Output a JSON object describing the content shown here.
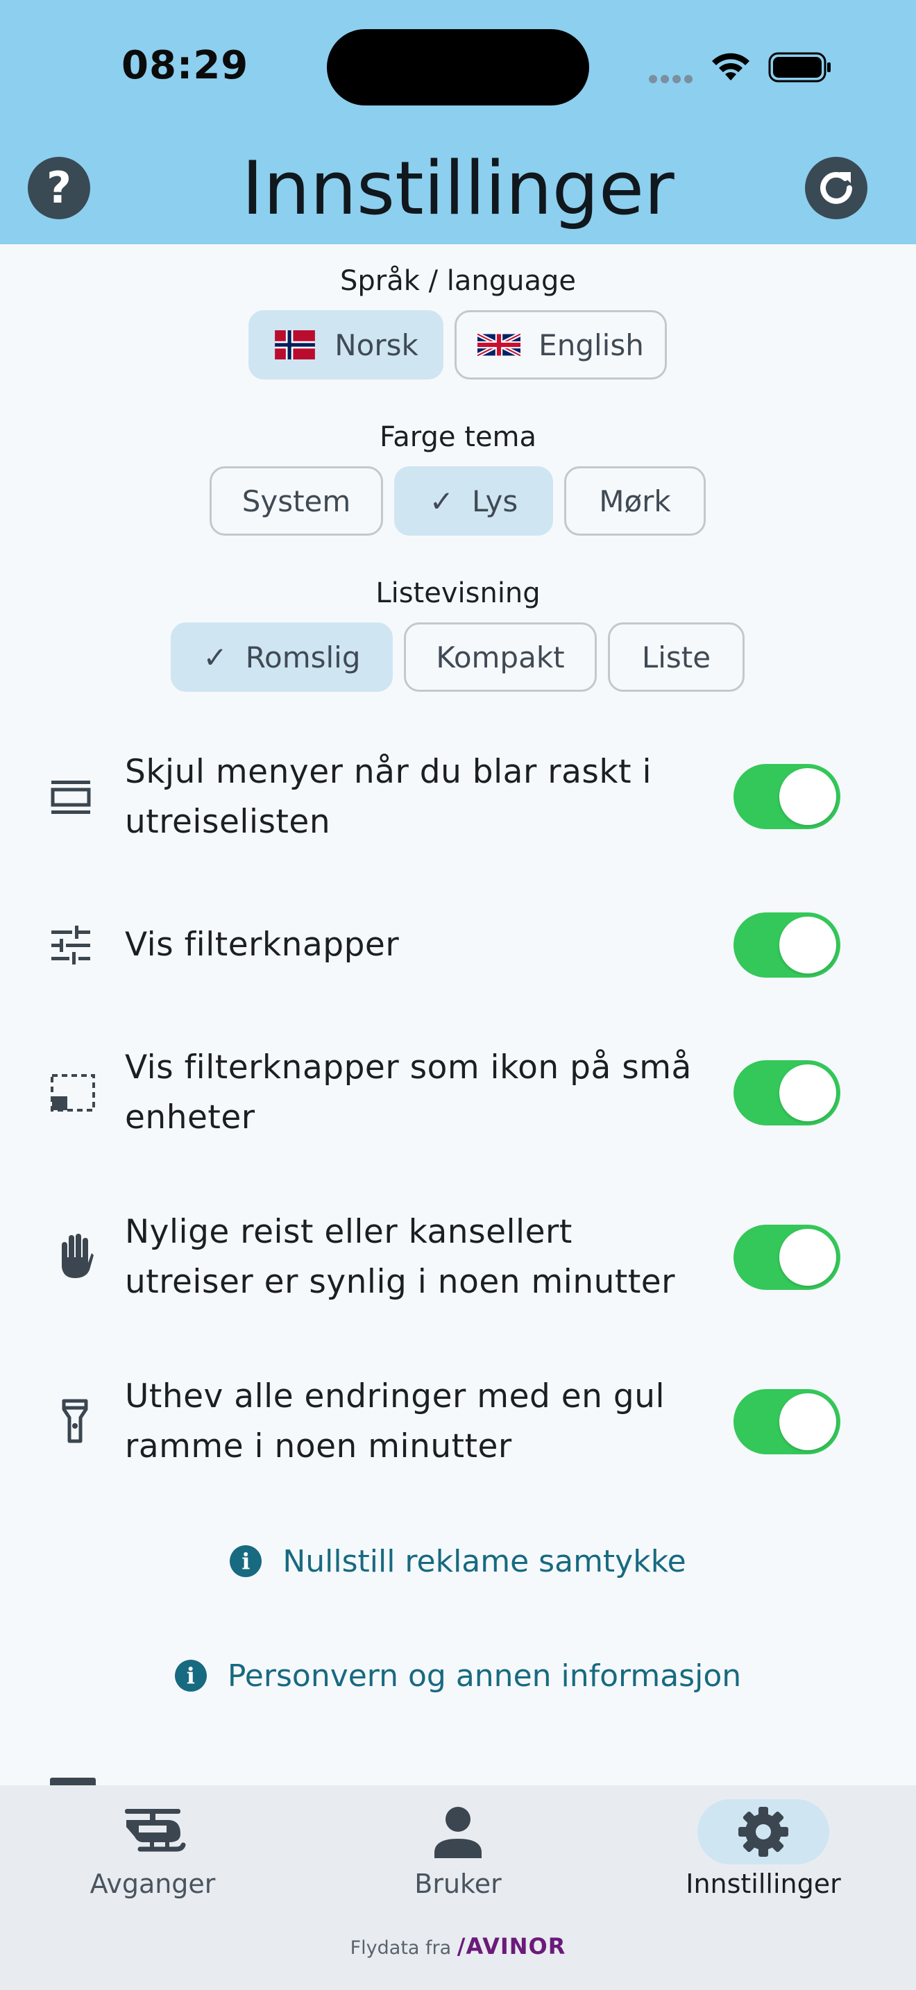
{
  "status_bar": {
    "time": "08:29"
  },
  "header": {
    "title": "Innstillinger",
    "help_icon": "help-icon",
    "refresh_icon": "refresh-icon"
  },
  "language": {
    "label": "Språk / language",
    "options": [
      {
        "label": "Norsk",
        "flag": "norway-flag",
        "selected": true
      },
      {
        "label": "English",
        "flag": "uk-flag",
        "selected": false
      }
    ]
  },
  "theme": {
    "label": "Farge tema",
    "options": [
      {
        "label": "System",
        "selected": false
      },
      {
        "label": "Lys",
        "selected": true
      },
      {
        "label": "Mørk",
        "selected": false
      }
    ]
  },
  "list_view": {
    "label": "Listevisning",
    "options": [
      {
        "label": "Romslig",
        "selected": true
      },
      {
        "label": "Kompakt",
        "selected": false
      },
      {
        "label": "Liste",
        "selected": false
      }
    ]
  },
  "settings": [
    {
      "icon": "hide-menu-icon",
      "text": "Skjul menyer når du blar raskt i utreiselisten",
      "enabled": true
    },
    {
      "icon": "filter-sliders-icon",
      "text": "Vis filterknapper",
      "enabled": true
    },
    {
      "icon": "small-screen-icon",
      "text": "Vis filterknapper som ikon på små enheter",
      "enabled": true
    },
    {
      "icon": "hand-icon",
      "text": "Nylige reist eller kansellert utreiser er synlig i noen minutter",
      "enabled": true
    },
    {
      "icon": "flashlight-icon",
      "text": "Uthev alle endringer med en gul ramme i noen minutter",
      "enabled": true
    }
  ],
  "links": [
    {
      "icon": "info-icon",
      "text": "Nullstill reklame samtykke"
    },
    {
      "icon": "info-icon",
      "text": "Personvern og annen informasjon"
    }
  ],
  "bottom_nav": [
    {
      "label": "Avganger",
      "icon": "helicopter-icon",
      "active": false
    },
    {
      "label": "Bruker",
      "icon": "person-icon",
      "active": false
    },
    {
      "label": "Innstillinger",
      "icon": "gear-icon",
      "active": true
    }
  ],
  "footer": {
    "prefix": "Flydata fra",
    "brand": "AVINOR"
  },
  "colors": {
    "header": "#8dcfee",
    "toggle_on": "#34c759",
    "link": "#176a80",
    "selected_segment": "#cfe5f2"
  }
}
